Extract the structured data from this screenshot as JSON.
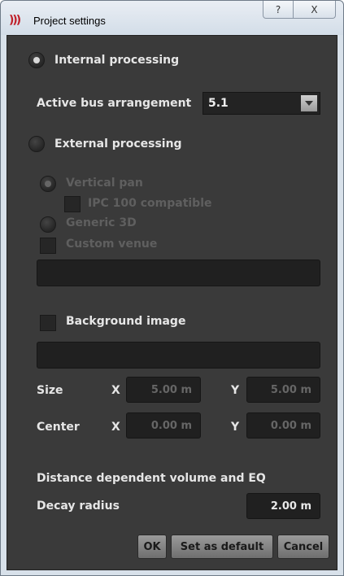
{
  "window": {
    "title": "Project settings",
    "help_glyph": "?",
    "close_glyph": "X"
  },
  "processing": {
    "internal_label": "Internal processing",
    "internal_selected": true,
    "bus_label": "Active bus arrangement",
    "bus_value": "5.1",
    "external_label": "External processing",
    "external_selected": false
  },
  "external": {
    "vertical_pan_label": "Vertical pan",
    "ipc_label": "IPC 100 compatible",
    "generic_label": "Generic 3D",
    "custom_venue_label": "Custom venue"
  },
  "background": {
    "label": "Background image",
    "size_label": "Size",
    "center_label": "Center",
    "x_label": "X",
    "y_label": "Y",
    "size_x": "5.00 m",
    "size_y": "5.00 m",
    "center_x": "0.00 m",
    "center_y": "0.00 m"
  },
  "distance": {
    "heading": "Distance dependent volume and EQ",
    "decay_label": "Decay radius",
    "decay_value": "2.00 m"
  },
  "buttons": {
    "ok": "OK",
    "set_default": "Set as default",
    "cancel": "Cancel"
  },
  "icons": {
    "app_logo": "app-logo-icon",
    "help": "help-icon",
    "close": "close-icon",
    "dropdown": "chevron-down-icon"
  }
}
